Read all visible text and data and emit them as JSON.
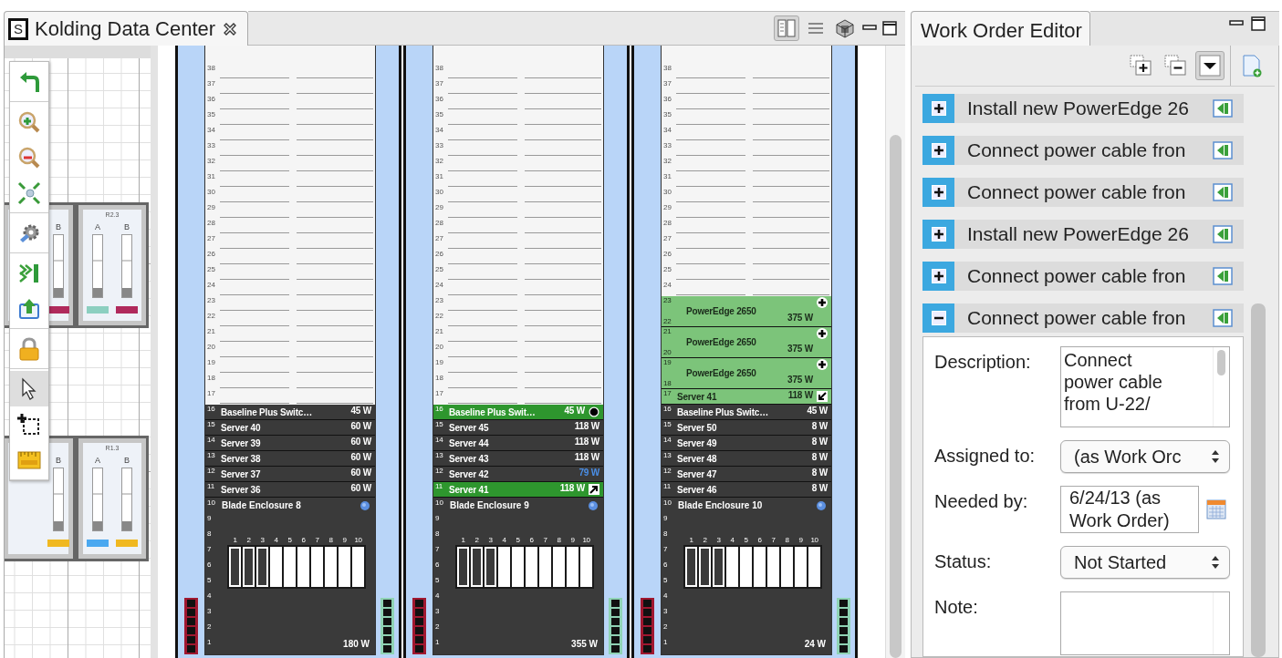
{
  "editor": {
    "tab": {
      "icon_letter": "S",
      "title": "Kolding Data Center"
    },
    "view_buttons": [
      {
        "kind": "split",
        "selected": true
      },
      {
        "kind": "list",
        "selected": false
      },
      {
        "kind": "cube",
        "selected": false
      }
    ],
    "floor_plan": {
      "racks": [
        {
          "columns": [
            {
              "label": "B",
              "color": "#b02a5c"
            }
          ]
        },
        {
          "title": "R2.3",
          "columns": [
            {
              "label": "A",
              "color": "#8ccfc0"
            },
            {
              "label": "B",
              "color": "#b02a5c"
            }
          ]
        },
        {
          "columns": [
            {
              "label": "B",
              "color": "#f0b820"
            }
          ]
        },
        {
          "title": "R1.3",
          "columns": [
            {
              "label": "A",
              "color": "#4aa8f0"
            },
            {
              "label": "B",
              "color": "#f0b820"
            }
          ]
        }
      ],
      "tool_groups": [
        {
          "tools": [
            {
              "kind": "undo",
              "selected": false
            }
          ]
        },
        {
          "tools": [
            {
              "kind": "zoom-in",
              "selected": false
            },
            {
              "kind": "zoom-out",
              "selected": false
            },
            {
              "kind": "fit",
              "selected": false
            }
          ]
        },
        {
          "tools": [
            {
              "kind": "gear",
              "selected": false
            }
          ]
        },
        {
          "tools": [
            {
              "kind": "flow",
              "selected": false
            },
            {
              "kind": "export",
              "selected": false
            }
          ]
        },
        {
          "tools": [
            {
              "kind": "lock",
              "selected": false
            }
          ]
        },
        {
          "tools": [
            {
              "kind": "pointer",
              "selected": true
            },
            {
              "kind": "marquee",
              "selected": false
            },
            {
              "kind": "ruler",
              "selected": false
            }
          ]
        }
      ]
    },
    "racks": [
      {
        "sections": [
          {
            "kind": "empty",
            "units": [
              "38",
              "37",
              "36",
              "35",
              "34",
              "33",
              "32",
              "31",
              "30",
              "29",
              "28",
              "27",
              "26",
              "25",
              "24",
              "23",
              "22",
              "21",
              "20",
              "19",
              "18",
              "17"
            ]
          },
          {
            "kind": "device",
            "units": [
              "16"
            ],
            "name": "Baseline Plus Switc…",
            "power": "45 W",
            "color": "#3a3a3a"
          },
          {
            "kind": "device",
            "units": [
              "15"
            ],
            "name": "Server 40",
            "power": "60 W",
            "color": "#3a3a3a"
          },
          {
            "kind": "device",
            "units": [
              "14"
            ],
            "name": "Server 39",
            "power": "60 W",
            "color": "#3a3a3a"
          },
          {
            "kind": "device",
            "units": [
              "13"
            ],
            "name": "Server 38",
            "power": "60 W",
            "color": "#3a3a3a"
          },
          {
            "kind": "device",
            "units": [
              "12"
            ],
            "name": "Server 37",
            "power": "60 W",
            "color": "#3a3a3a"
          },
          {
            "kind": "device",
            "units": [
              "11"
            ],
            "name": "Server 36",
            "power": "60 W",
            "color": "#3a3a3a"
          },
          {
            "kind": "blade",
            "units": [
              "10",
              "9",
              "8",
              "7",
              "6",
              "5",
              "4",
              "3",
              "2",
              "1"
            ],
            "name": "Blade Enclosure 8",
            "power": "180 W",
            "slots": [
              {
                "label": "1",
                "filled": false
              },
              {
                "label": "2",
                "filled": false
              },
              {
                "label": "3",
                "filled": false
              },
              {
                "label": "4",
                "filled": true
              },
              {
                "label": "5",
                "filled": true
              },
              {
                "label": "6",
                "filled": true
              },
              {
                "label": "7",
                "filled": true
              },
              {
                "label": "8",
                "filled": true
              },
              {
                "label": "9",
                "filled": true
              },
              {
                "label": "10",
                "filled": true
              }
            ]
          }
        ]
      },
      {
        "sections": [
          {
            "kind": "empty",
            "units": [
              "38",
              "37",
              "36",
              "35",
              "34",
              "33",
              "32",
              "31",
              "30",
              "29",
              "28",
              "27",
              "26",
              "25",
              "24",
              "23",
              "22",
              "21",
              "20",
              "19",
              "18",
              "17"
            ]
          },
          {
            "kind": "device",
            "units": [
              "16"
            ],
            "name": "Baseline Plus Swit…",
            "power": "45 W",
            "color": "#2e962e",
            "badge": {
              "kind": "dial"
            }
          },
          {
            "kind": "device",
            "units": [
              "15"
            ],
            "name": "Server 45",
            "power": "118 W",
            "color": "#3a3a3a"
          },
          {
            "kind": "device",
            "units": [
              "14"
            ],
            "name": "Server 44",
            "power": "118 W",
            "color": "#3a3a3a"
          },
          {
            "kind": "device",
            "units": [
              "13"
            ],
            "name": "Server 43",
            "power": "118 W",
            "color": "#3a3a3a"
          },
          {
            "kind": "device",
            "units": [
              "12"
            ],
            "name": "Server 42",
            "power": "79 W",
            "color": "#3a3a3a",
            "power_warning": true
          },
          {
            "kind": "device",
            "units": [
              "11"
            ],
            "name": "Server 41",
            "power": "118 W",
            "color": "#2e962e",
            "badge": {
              "kind": "move-out"
            }
          },
          {
            "kind": "blade",
            "units": [
              "10",
              "9",
              "8",
              "7",
              "6",
              "5",
              "4",
              "3",
              "2",
              "1"
            ],
            "name": "Blade Enclosure 9",
            "power": "355 W",
            "slots": [
              {
                "label": "1",
                "filled": false
              },
              {
                "label": "2",
                "filled": false
              },
              {
                "label": "3",
                "filled": false
              },
              {
                "label": "4",
                "filled": true
              },
              {
                "label": "5",
                "filled": true
              },
              {
                "label": "6",
                "filled": true
              },
              {
                "label": "7",
                "filled": true
              },
              {
                "label": "8",
                "filled": true
              },
              {
                "label": "9",
                "filled": true
              },
              {
                "label": "10",
                "filled": true
              }
            ]
          }
        ]
      },
      {
        "sections": [
          {
            "kind": "empty",
            "units": [
              "38",
              "37",
              "36",
              "35",
              "34",
              "33",
              "32",
              "31",
              "30",
              "29",
              "28",
              "27",
              "26",
              "25",
              "24"
            ]
          },
          {
            "kind": "device",
            "units": [
              "23",
              "22"
            ],
            "name": "PowerEdge 2650",
            "power": "375 W",
            "color": "#7cc47a",
            "badge": {
              "kind": "add"
            }
          },
          {
            "kind": "device",
            "units": [
              "21",
              "20"
            ],
            "name": "PowerEdge 2650",
            "power": "375 W",
            "color": "#7cc47a",
            "badge": {
              "kind": "add"
            }
          },
          {
            "kind": "device",
            "units": [
              "19",
              "18"
            ],
            "name": "PowerEdge 2650",
            "power": "375 W",
            "color": "#7cc47a",
            "badge": {
              "kind": "add"
            }
          },
          {
            "kind": "device",
            "units": [
              "17"
            ],
            "name": "Server 41",
            "power": "118 W",
            "color": "#7cc47a",
            "badge": {
              "kind": "move-in"
            }
          },
          {
            "kind": "device",
            "units": [
              "16"
            ],
            "name": "Baseline Plus Switc…",
            "power": "45 W",
            "color": "#3a3a3a"
          },
          {
            "kind": "device",
            "units": [
              "15"
            ],
            "name": "Server 50",
            "power": "8 W",
            "color": "#3a3a3a"
          },
          {
            "kind": "device",
            "units": [
              "14"
            ],
            "name": "Server 49",
            "power": "8 W",
            "color": "#3a3a3a"
          },
          {
            "kind": "device",
            "units": [
              "13"
            ],
            "name": "Server 48",
            "power": "8 W",
            "color": "#3a3a3a"
          },
          {
            "kind": "device",
            "units": [
              "12"
            ],
            "name": "Server 47",
            "power": "8 W",
            "color": "#3a3a3a"
          },
          {
            "kind": "device",
            "units": [
              "11"
            ],
            "name": "Server 46",
            "power": "8 W",
            "color": "#3a3a3a"
          },
          {
            "kind": "blade",
            "units": [
              "10",
              "9",
              "8",
              "7",
              "6",
              "5",
              "4",
              "3",
              "2",
              "1"
            ],
            "name": "Blade Enclosure 10",
            "power": "24 W",
            "slots": [
              {
                "label": "1",
                "filled": false
              },
              {
                "label": "2",
                "filled": false
              },
              {
                "label": "3",
                "filled": false
              },
              {
                "label": "4",
                "filled": true
              },
              {
                "label": "5",
                "filled": true
              },
              {
                "label": "6",
                "filled": true
              },
              {
                "label": "7",
                "filled": true
              },
              {
                "label": "8",
                "filled": true
              },
              {
                "label": "9",
                "filled": true
              },
              {
                "label": "10",
                "filled": true
              }
            ]
          }
        ]
      }
    ]
  },
  "work_order_editor": {
    "tab": {
      "title": "Work Order Editor"
    },
    "toolbar": [
      {
        "kind": "expand-all",
        "selected": false
      },
      {
        "kind": "collapse-all",
        "selected": false
      },
      {
        "kind": "menu",
        "selected": true
      },
      {
        "kind": "new",
        "selected": false
      }
    ],
    "orders": [
      {
        "title": "Install new PowerEdge 26",
        "expanded": false
      },
      {
        "title": "Connect power cable fron",
        "expanded": false
      },
      {
        "title": "Connect power cable fron",
        "expanded": false
      },
      {
        "title": "Install new PowerEdge 26",
        "expanded": false
      },
      {
        "title": "Connect power cable fron",
        "expanded": false
      },
      {
        "title": "Connect power cable fron",
        "expanded": true
      }
    ],
    "details": {
      "fields": [
        {
          "kind": "textarea",
          "label": "Description:",
          "value": "Connect power cable from U-22/"
        },
        {
          "kind": "select",
          "label": "Assigned to:",
          "value": "(as Work Orc"
        },
        {
          "kind": "date",
          "label": "Needed by:",
          "value": "6/24/13 (as Work Order)"
        },
        {
          "kind": "select",
          "label": "Status:",
          "value": "Not Started"
        },
        {
          "kind": "textarea",
          "label": "Note:"
        }
      ]
    }
  }
}
